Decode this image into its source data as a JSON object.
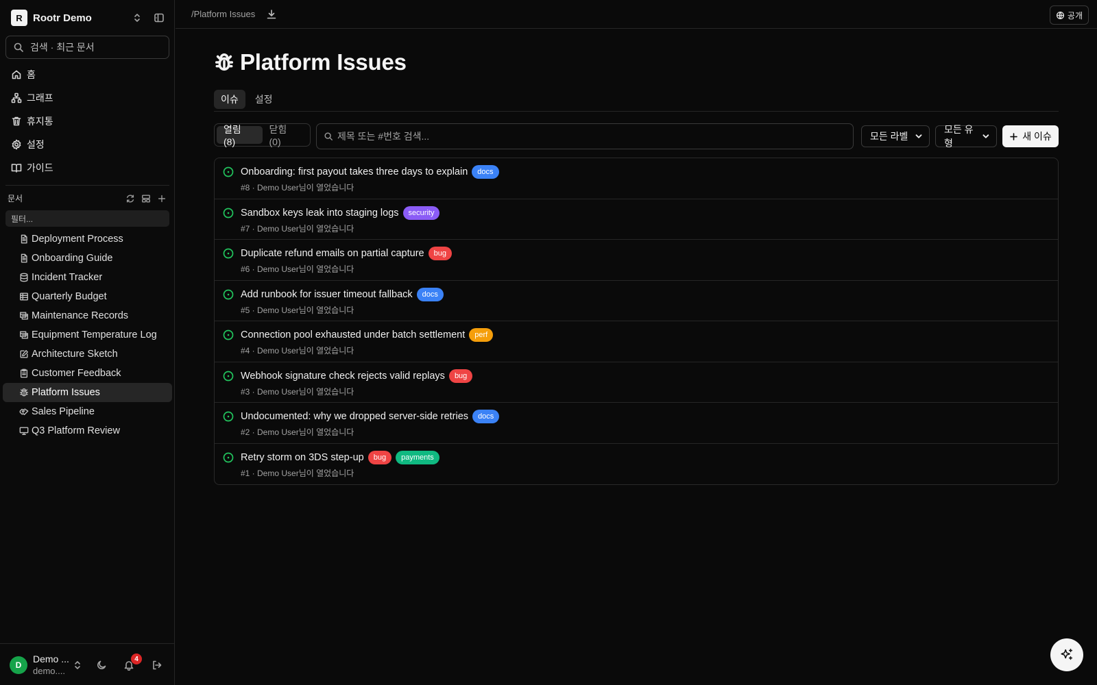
{
  "workspace": {
    "logo_letter": "R",
    "name": "Rootr Demo"
  },
  "sidebar": {
    "search_placeholder": "검색 · 최근 문서",
    "nav": [
      {
        "label": "홈",
        "icon": "home-icon"
      },
      {
        "label": "그래프",
        "icon": "graph-icon"
      },
      {
        "label": "휴지통",
        "icon": "trash-icon"
      },
      {
        "label": "설정",
        "icon": "gear-icon"
      },
      {
        "label": "가이드",
        "icon": "book-icon"
      }
    ],
    "docs_heading": "문서",
    "filter_placeholder": "필터...",
    "documents": [
      {
        "label": "Deployment Process",
        "icon": "document-icon"
      },
      {
        "label": "Onboarding Guide",
        "icon": "document-icon"
      },
      {
        "label": "Incident Tracker",
        "icon": "database-icon"
      },
      {
        "label": "Quarterly Budget",
        "icon": "table-icon"
      },
      {
        "label": "Maintenance Records",
        "icon": "sheet-icon"
      },
      {
        "label": "Equipment Temperature Log",
        "icon": "sheet-icon"
      },
      {
        "label": "Architecture Sketch",
        "icon": "pencil-square-icon"
      },
      {
        "label": "Customer Feedback",
        "icon": "clipboard-icon"
      },
      {
        "label": "Platform Issues",
        "icon": "bug-icon",
        "active": true
      },
      {
        "label": "Sales Pipeline",
        "icon": "handshake-icon"
      },
      {
        "label": "Q3 Platform Review",
        "icon": "presentation-icon"
      }
    ]
  },
  "user": {
    "avatar_letter": "D",
    "name": "Demo ...",
    "email": "demo....",
    "notification_count": "4"
  },
  "topbar": {
    "breadcrumb": "/Platform Issues",
    "publish_label": "공개"
  },
  "page": {
    "title": "Platform Issues",
    "tabs": [
      {
        "label": "이슈",
        "active": true
      },
      {
        "label": "설정",
        "active": false
      }
    ],
    "open_label": "열림 (8)",
    "closed_label": "닫힘 (0)",
    "search_placeholder": "제목 또는 #번호 검색...",
    "label_filter": "모든 라벨",
    "type_filter": "모든 유형",
    "new_issue_label": "새 이슈"
  },
  "label_colors": {
    "docs": "#3b82f6",
    "security": "#8b5cf6",
    "bug": "#ef4444",
    "perf": "#f59e0b",
    "payments": "#10b981"
  },
  "issues": [
    {
      "title": "Onboarding: first payout takes three days to explain",
      "labels": [
        "docs"
      ],
      "meta": "#8 · Demo User님이 열었습니다"
    },
    {
      "title": "Sandbox keys leak into staging logs",
      "labels": [
        "security"
      ],
      "meta": "#7 · Demo User님이 열었습니다"
    },
    {
      "title": "Duplicate refund emails on partial capture",
      "labels": [
        "bug"
      ],
      "meta": "#6 · Demo User님이 열었습니다"
    },
    {
      "title": "Add runbook for issuer timeout fallback",
      "labels": [
        "docs"
      ],
      "meta": "#5 · Demo User님이 열었습니다"
    },
    {
      "title": "Connection pool exhausted under batch settlement",
      "labels": [
        "perf"
      ],
      "meta": "#4 · Demo User님이 열었습니다"
    },
    {
      "title": "Webhook signature check rejects valid replays",
      "labels": [
        "bug"
      ],
      "meta": "#3 · Demo User님이 열었습니다"
    },
    {
      "title": "Undocumented: why we dropped server-side retries",
      "labels": [
        "docs"
      ],
      "meta": "#2 · Demo User님이 열었습니다"
    },
    {
      "title": "Retry storm on 3DS step-up",
      "labels": [
        "bug",
        "payments"
      ],
      "meta": "#1 · Demo User님이 열었습니다"
    }
  ]
}
